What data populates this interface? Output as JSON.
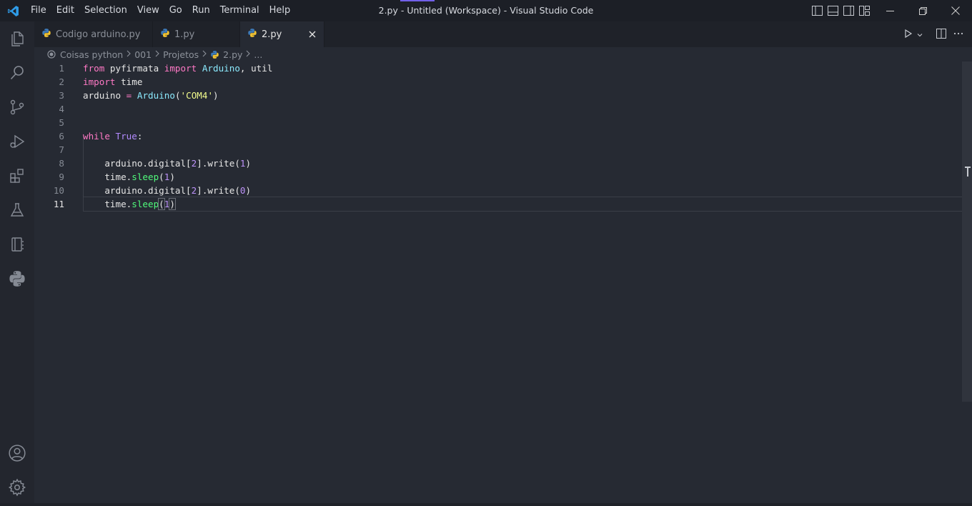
{
  "titlebar": {
    "logo": "vscode-logo-icon",
    "menu": [
      "File",
      "Edit",
      "Selection",
      "View",
      "Go",
      "Run",
      "Terminal",
      "Help"
    ],
    "window_title": "2.py - Untitled (Workspace) - Visual Studio Code"
  },
  "tabs": [
    {
      "label": "Codigo arduino.py",
      "icon": "python-icon",
      "active": false
    },
    {
      "label": "1.py",
      "icon": "python-icon",
      "active": false
    },
    {
      "label": "2.py",
      "icon": "python-icon",
      "active": true,
      "close": "×"
    }
  ],
  "breadcrumb": {
    "items": [
      "Coisas python",
      "001",
      "Projetos",
      "2.py",
      "..."
    ],
    "separator": ">"
  },
  "editor": {
    "current_line": 11,
    "line_numbers": [
      "1",
      "2",
      "3",
      "4",
      "5",
      "6",
      "7",
      "8",
      "9",
      "10",
      "11"
    ],
    "lines": [
      "from pyfirmata import Arduino, util",
      "import time",
      "arduino = Arduino('COM4')",
      "",
      "",
      "while True:",
      "",
      "    arduino.digital[2].write(1)",
      "    time.sleep(1)",
      "    arduino.digital[2].write(0)",
      "    time.sleep(1)"
    ]
  },
  "activitybar": {
    "items": [
      "explorer-icon",
      "search-icon",
      "source-control-icon",
      "run-debug-icon",
      "extensions-icon",
      "testing-icon",
      "notebook-icon",
      "python-icon"
    ],
    "bottom": [
      "accounts-icon",
      "settings-gear-icon"
    ]
  },
  "colors": {
    "keyword": "#ff79c6",
    "constant": "#b38bff",
    "class": "#8be9fd",
    "string": "#f1fa8c",
    "number": "#bd93f9",
    "function": "#50fa7b",
    "accent": "#7160e8"
  }
}
